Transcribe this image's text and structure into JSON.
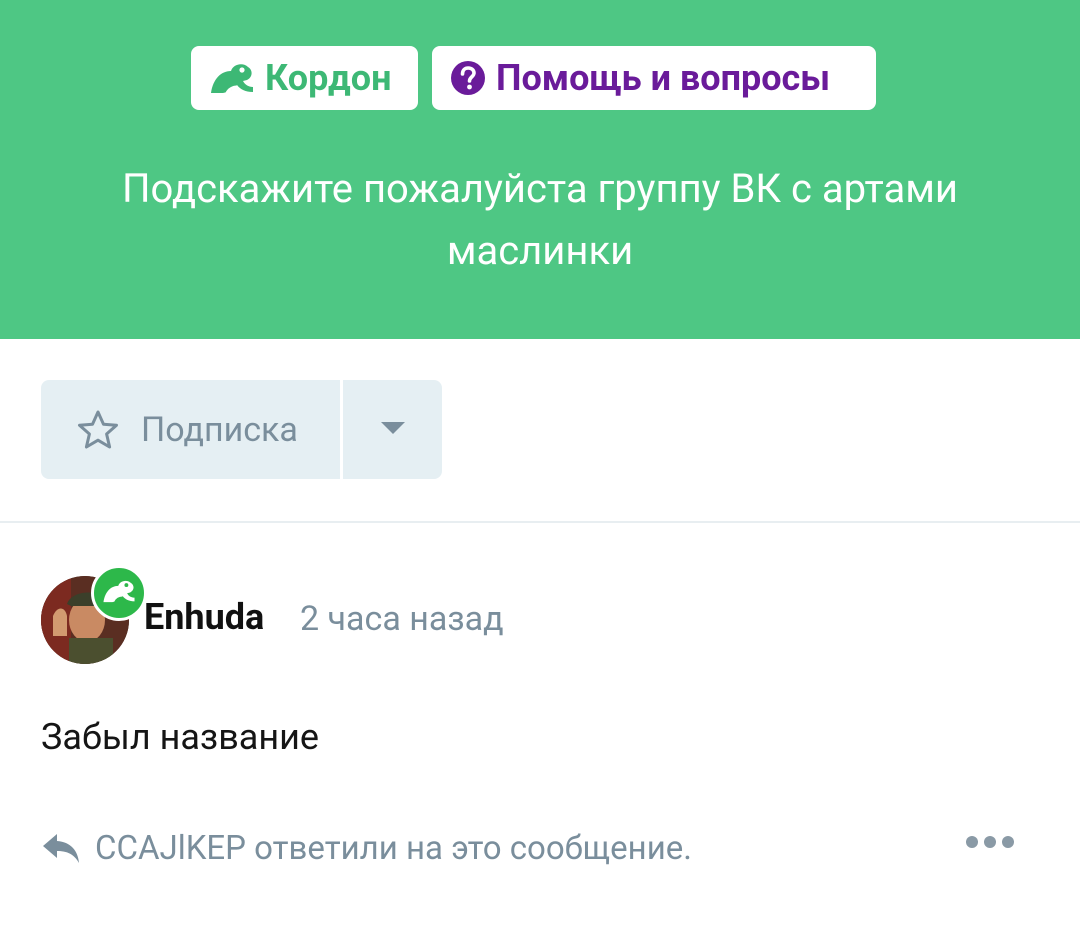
{
  "header": {
    "tags": [
      {
        "label": "Кордон",
        "icon": "frog-icon",
        "color": "#3db875"
      },
      {
        "label": "Помощь и вопросы",
        "icon": "question-circle-icon",
        "color": "#6a1b9a"
      }
    ],
    "title": "Подскажите пожалуйста группу ВК с артами маслинки",
    "background": "#4ec784"
  },
  "subscribe": {
    "label": "Подписка",
    "icon": "star-outline-icon",
    "dropdown_icon": "caret-down-icon"
  },
  "post": {
    "author": "Enhuda",
    "time": "2 часа назад",
    "badge_icon": "frog-icon",
    "message": "Забыл название",
    "reply_text": "CCAJlKEP ответили на это сообщение.",
    "reply_icon": "reply-arrow-icon",
    "more_icon": "ellipsis-icon"
  }
}
